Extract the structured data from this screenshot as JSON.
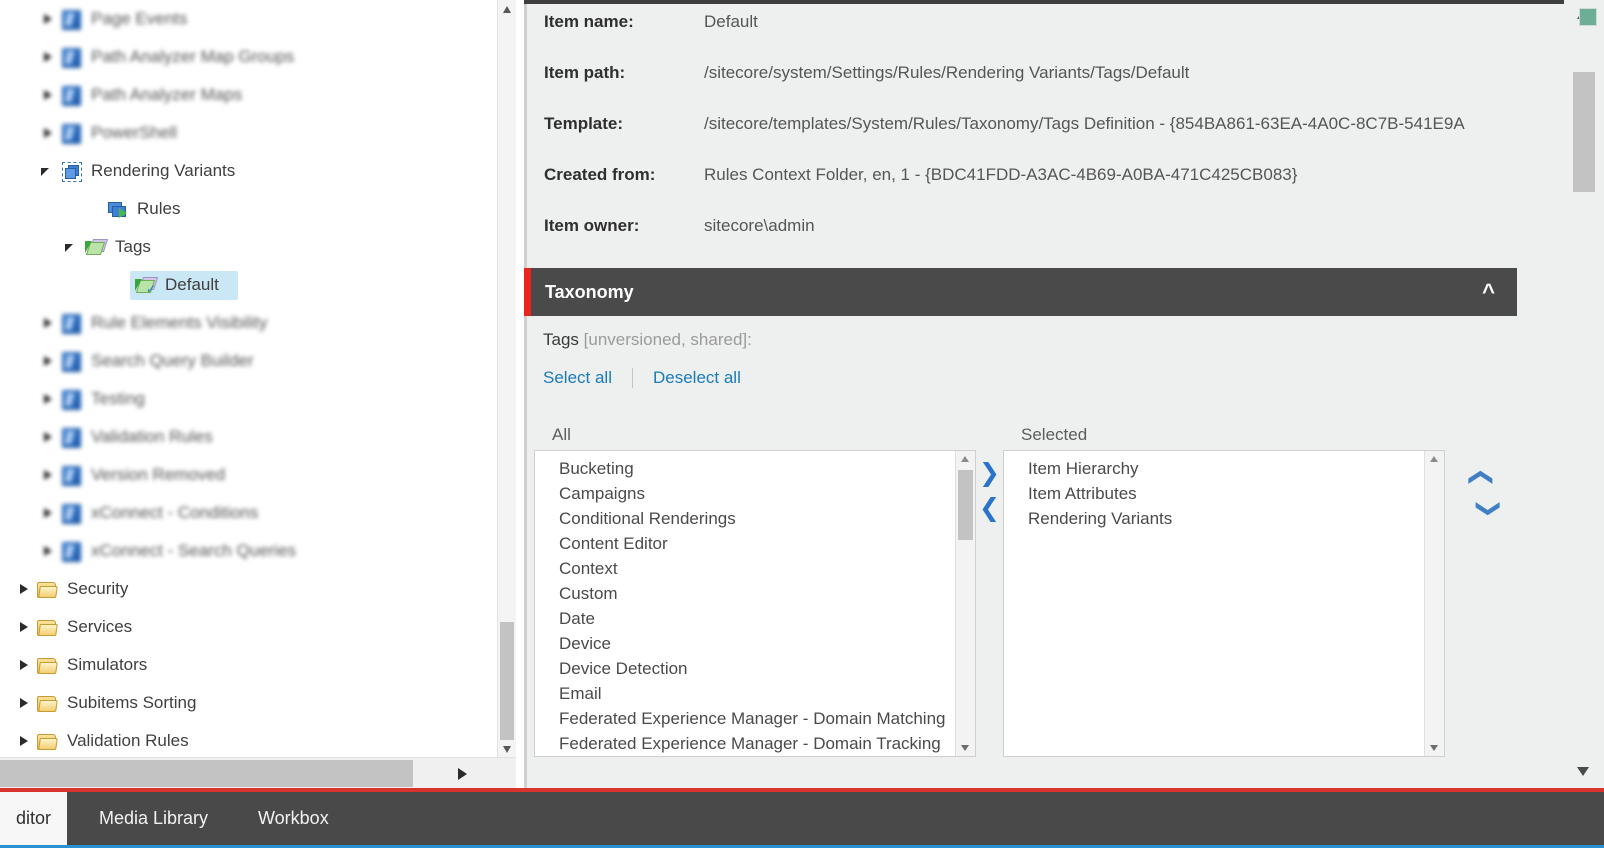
{
  "tree": {
    "items": [
      {
        "label": "Page Events",
        "icon": "blue-item-icon",
        "indent": 40,
        "twisty": "right",
        "blurred": true,
        "selected": false
      },
      {
        "label": "Path Analyzer Map Groups",
        "icon": "blue-item-icon",
        "indent": 40,
        "twisty": "right",
        "blurred": true,
        "selected": false
      },
      {
        "label": "Path Analyzer Maps",
        "icon": "blue-item-icon",
        "indent": 40,
        "twisty": "right",
        "blurred": true,
        "selected": false
      },
      {
        "label": "PowerShell",
        "icon": "blue-item-icon",
        "indent": 40,
        "twisty": "right",
        "blurred": true,
        "selected": false
      },
      {
        "label": "Rendering Variants",
        "icon": "rendering-variants-icon",
        "indent": 40,
        "twisty": "down",
        "blurred": false,
        "selected": false
      },
      {
        "label": "Rules",
        "icon": "rules-icon",
        "indent": 86,
        "twisty": "none",
        "blurred": false,
        "selected": false
      },
      {
        "label": "Tags",
        "icon": "tags-icon",
        "indent": 64,
        "twisty": "down",
        "blurred": false,
        "selected": false
      },
      {
        "label": "Default",
        "icon": "tag-checked-icon",
        "indent": 110,
        "twisty": "none",
        "blurred": false,
        "selected": true
      },
      {
        "label": "Rule Elements Visibility",
        "icon": "blue-item-icon",
        "indent": 40,
        "twisty": "right",
        "blurred": true,
        "selected": false
      },
      {
        "label": "Search Query Builder",
        "icon": "blue-item-icon",
        "indent": 40,
        "twisty": "right",
        "blurred": true,
        "selected": false
      },
      {
        "label": "Testing",
        "icon": "blue-item-icon",
        "indent": 40,
        "twisty": "right",
        "blurred": true,
        "selected": false
      },
      {
        "label": "Validation Rules",
        "icon": "blue-item-icon",
        "indent": 40,
        "twisty": "right",
        "blurred": true,
        "selected": false
      },
      {
        "label": "Version Removed",
        "icon": "blue-item-icon",
        "indent": 40,
        "twisty": "right",
        "blurred": true,
        "selected": false
      },
      {
        "label": "xConnect - Conditions",
        "icon": "blue-item-icon",
        "indent": 40,
        "twisty": "right",
        "blurred": true,
        "selected": false
      },
      {
        "label": "xConnect - Search Queries",
        "icon": "blue-item-icon",
        "indent": 40,
        "twisty": "right",
        "blurred": true,
        "selected": false
      },
      {
        "label": "Security",
        "icon": "folder-icon",
        "indent": 16,
        "twisty": "right",
        "blurred": false,
        "selected": false
      },
      {
        "label": "Services",
        "icon": "folder-icon",
        "indent": 16,
        "twisty": "right",
        "blurred": false,
        "selected": false
      },
      {
        "label": "Simulators",
        "icon": "folder-icon",
        "indent": 16,
        "twisty": "right",
        "blurred": false,
        "selected": false
      },
      {
        "label": "Subitems Sorting",
        "icon": "folder-icon",
        "indent": 16,
        "twisty": "right",
        "blurred": false,
        "selected": false
      },
      {
        "label": "Validation Rules",
        "icon": "folder-icon",
        "indent": 16,
        "twisty": "right",
        "blurred": false,
        "selected": false
      }
    ]
  },
  "detail": {
    "fields": [
      {
        "label": "Item name:",
        "value": "Default"
      },
      {
        "label": "Item path:",
        "value": "/sitecore/system/Settings/Rules/Rendering Variants/Tags/Default"
      },
      {
        "label": "Template:",
        "value": "/sitecore/templates/System/Rules/Taxonomy/Tags Definition - {854BA861-63EA-4A0C-8C7B-541E9A"
      },
      {
        "label": "Created from:",
        "value": "Rules Context Folder, en, 1 - {BDC41FDD-A3AC-4B69-A0BA-471C425CB083}"
      },
      {
        "label": "Item owner:",
        "value": "sitecore\\admin"
      }
    ],
    "section": {
      "title": "Taxonomy",
      "collapse_icon": "chevron-up-icon",
      "accent_color": "#e8261c",
      "header_bg": "#4a4a4a"
    },
    "taxonomy": {
      "field_label": "Tags",
      "field_meta": " [unversioned, shared]:",
      "select_all": "Select all",
      "deselect_all": "Deselect all",
      "all_caption": "All",
      "selected_caption": "Selected",
      "all_options": [
        "Bucketing",
        "Campaigns",
        "Conditional Renderings",
        "Content Editor",
        "Context",
        "Custom",
        "Date",
        "Device",
        "Device Detection",
        "Email",
        "Federated Experience Manager - Domain Matching",
        "Federated Experience Manager - Domain Tracking"
      ],
      "selected_options": [
        "Item Hierarchy",
        "Item Attributes",
        "Rendering Variants"
      ],
      "move_right_icon": "chevron-right-icon",
      "move_left_icon": "chevron-left-icon",
      "move_up_icon": "chevron-up-icon",
      "move_down_icon": "chevron-down-icon"
    }
  },
  "tabbar": {
    "tabs": [
      {
        "label": "ditor",
        "active": true
      },
      {
        "label": "Media Library",
        "active": false
      },
      {
        "label": "Workbox",
        "active": false
      }
    ],
    "accent_top": "#d9342b",
    "accent_bottom": "#2a92d4"
  }
}
